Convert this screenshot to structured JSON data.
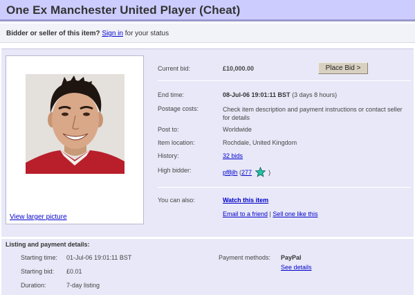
{
  "title": "One Ex Manchester United Player (Cheat)",
  "status_bar": {
    "prompt": "Bidder or seller of this item?",
    "sign_in_label": "Sign in",
    "suffix": "for your status"
  },
  "photo": {
    "view_larger_label": "View larger picture"
  },
  "bid": {
    "current_bid_label": "Current bid:",
    "current_bid_value": "£10,000.00",
    "place_bid_label": "Place Bid >"
  },
  "details": {
    "end_time_label": "End time:",
    "end_time_value": "08-Jul-06 19:01:11 BST",
    "end_time_remaining": "(3 days 8 hours)",
    "postage_label": "Postage costs:",
    "postage_value": "Check item description and payment instructions or contact seller for details",
    "post_to_label": "Post to:",
    "post_to_value": "Worldwide",
    "location_label": "Item location:",
    "location_value": "Rochdale, United Kingdom",
    "history_label": "History:",
    "history_value": "32 bids",
    "high_bidder_label": "High bidder:",
    "high_bidder_name": "pf8jlh",
    "feedback_open": "(",
    "feedback_score": "277",
    "feedback_close": ")",
    "star_color": "#22c4a8"
  },
  "also": {
    "label": "You can also:",
    "watch_label": "Watch this item",
    "email_label": "Email to a friend",
    "divider": "|",
    "sell_label": "Sell one like this"
  },
  "listing": {
    "heading": "Listing and payment details:",
    "starting_time_label": "Starting time:",
    "starting_time_value": "01-Jul-06 19:01:11 BST",
    "starting_bid_label": "Starting bid:",
    "starting_bid_value": "£0.01",
    "duration_label": "Duration:",
    "duration_value": "7-day listing",
    "payment_label": "Payment methods:",
    "payment_value": "PayPal",
    "see_details_label": "See details"
  },
  "colors": {
    "title_bar": "#ccccff",
    "panel": "#e8e8f8",
    "link": "#0000cc"
  }
}
